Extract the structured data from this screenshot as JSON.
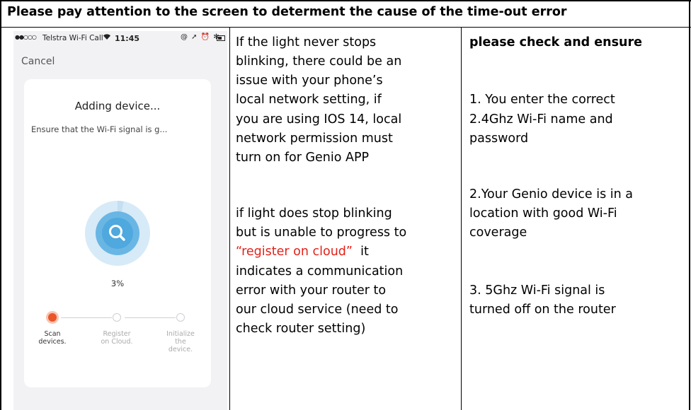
{
  "header": {
    "title": "Please pay attention to the screen to determent the cause of the time-out error"
  },
  "phone": {
    "status_bar": {
      "signal": "●●○○○",
      "carrier": "Telstra Wi-Fi Call",
      "wifi_icon": "wifi-icon",
      "time": "11:45",
      "status_icons": "@ ➚ ⏰ ✻"
    },
    "cancel_label": "Cancel",
    "adding_title": "Adding device...",
    "ensure_text": "Ensure that the Wi-Fi signal is g...",
    "progress_percent_label": "3%",
    "progress_fraction": 0.03,
    "colors": {
      "accent": "#e8562a",
      "ring_outer": "#cfe6f6",
      "ring_inner": "#5fb3e3",
      "search_circle": "#4aa6dd"
    },
    "steps": [
      {
        "label": "Scan\ndevices.",
        "active": true
      },
      {
        "label": "Register\non Cloud.",
        "active": false
      },
      {
        "label": "Initialize\nthe\ndevice.",
        "active": false
      }
    ]
  },
  "middle_column": {
    "lines": [
      "If the light never stops",
      "blinking, there could be an",
      "issue with your phone’s",
      "local network setting, if",
      "you are using IOS 14, local",
      "network permission must",
      "turn on for Genio APP",
      "",
      "if light does stop blinking",
      "but is unable to progress to"
    ],
    "register_quote_open": "“",
    "register_text": "register on cloud",
    "register_quote_close": "”",
    "register_after": "  it",
    "lines_after": [
      "indicates a communication",
      "error with your router to",
      "our cloud service (need to",
      "check router setting)"
    ]
  },
  "right_column": {
    "heading": "please check and ensure",
    "lines": [
      "1. You enter the correct",
      "2.4Ghz Wi-Fi name and",
      "password",
      "",
      "2.Your Genio device is in a",
      "location with good Wi-Fi",
      "coverage",
      "",
      "3. 5Ghz Wi-Fi signal is",
      "turned off on the router"
    ]
  }
}
